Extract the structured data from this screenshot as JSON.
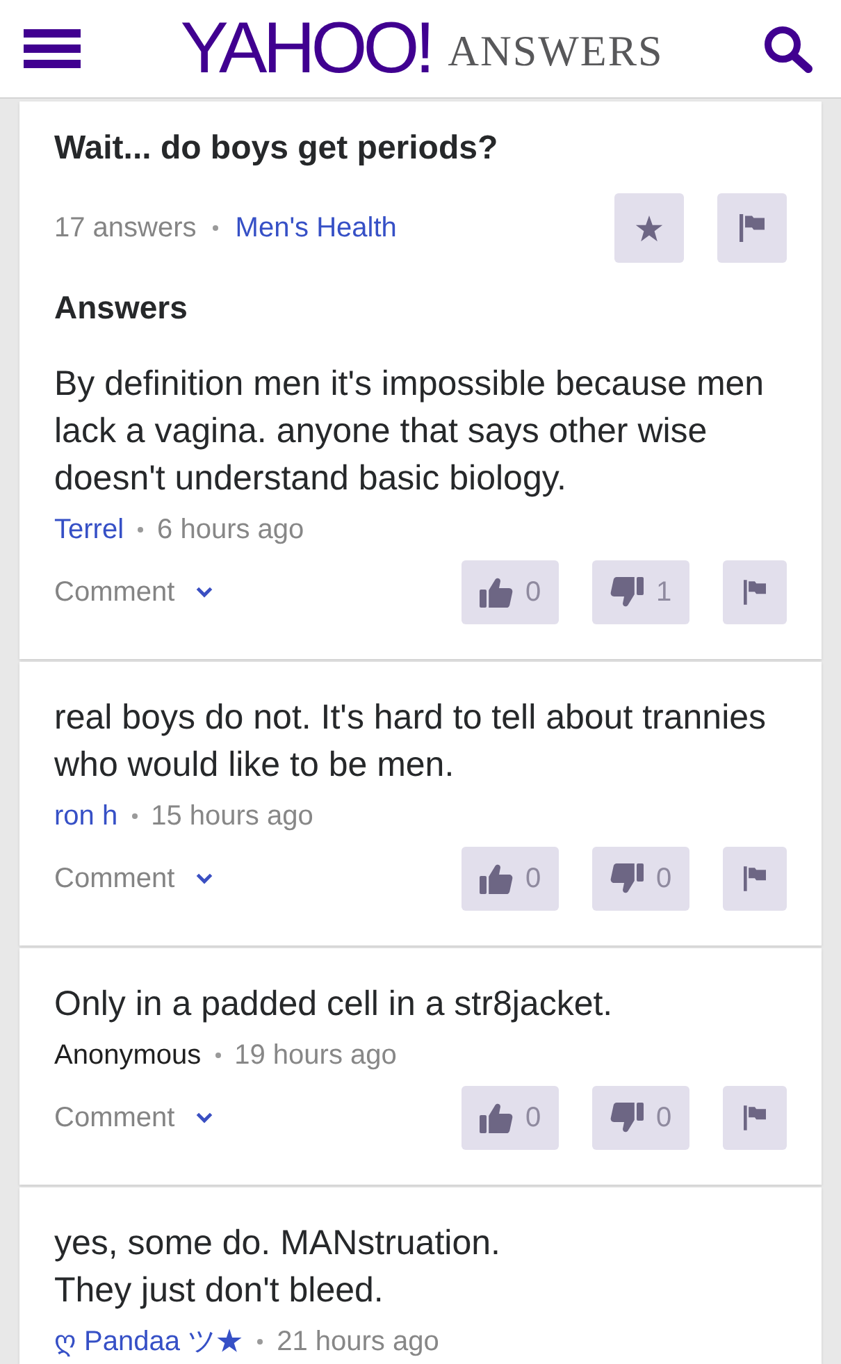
{
  "header": {
    "logo": "YAHOO!",
    "logo_subtitle": "ANSWERS"
  },
  "question": {
    "title": "Wait... do boys get periods?",
    "answer_count": "17 answers",
    "category": "Men's Health",
    "answers_heading": "Answers"
  },
  "answers": [
    {
      "text": "By definition men it's impossible because men lack a vagina. anyone that says other wise doesn't understand basic biology.",
      "author": "Terrel",
      "author_linked": true,
      "time": "6 hours ago",
      "comment": "Comment",
      "thumbs_up": "0",
      "thumbs_down": "1"
    },
    {
      "text": "real boys do not. It's hard to tell about trannies who would like to be men.",
      "author": "ron h",
      "author_linked": true,
      "time": "15 hours ago",
      "comment": "Comment",
      "thumbs_up": "0",
      "thumbs_down": "0"
    },
    {
      "text": "Only in a padded cell in a str8jacket.",
      "author": "Anonymous",
      "author_linked": false,
      "time": "19 hours ago",
      "comment": "Comment",
      "thumbs_up": "0",
      "thumbs_down": "0"
    },
    {
      "text": "yes, some do. MANstruation.\nThey just don't bleed.",
      "author": "ღ Pandaa ツ★",
      "author_linked": true,
      "time": "21 hours ago"
    }
  ]
}
